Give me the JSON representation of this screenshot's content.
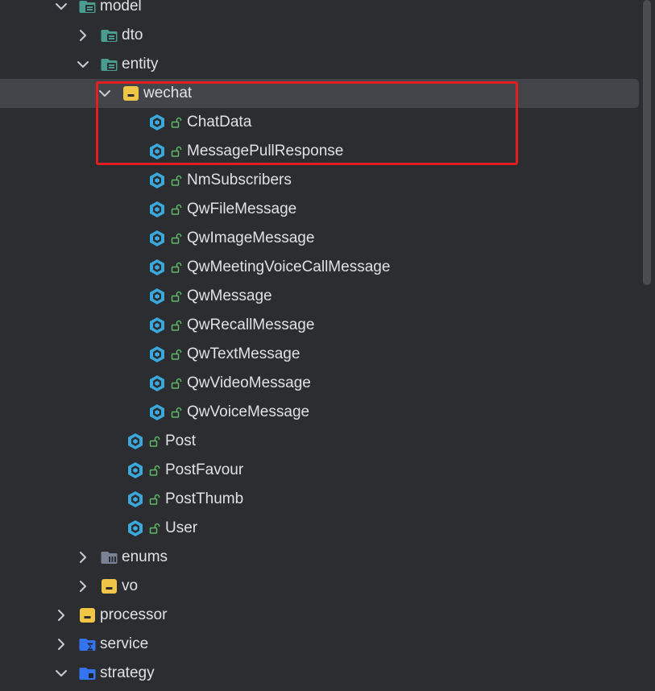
{
  "tree": {
    "rows": [
      {
        "label": "model",
        "icon": "folder-package-icon",
        "expanded": true
      },
      {
        "label": "dto",
        "icon": "folder-package-icon",
        "expanded": false
      },
      {
        "label": "entity",
        "icon": "folder-package-icon",
        "expanded": true
      },
      {
        "label": "wechat",
        "icon": "folder-yellow-icon",
        "expanded": true,
        "selected": true
      },
      {
        "label": "ChatData",
        "icon": "class-icon"
      },
      {
        "label": "MessagePullResponse",
        "icon": "class-icon"
      },
      {
        "label": "NmSubscribers",
        "icon": "class-icon"
      },
      {
        "label": "QwFileMessage",
        "icon": "class-icon"
      },
      {
        "label": "QwImageMessage",
        "icon": "class-icon"
      },
      {
        "label": "QwMeetingVoiceCallMessage",
        "icon": "class-icon"
      },
      {
        "label": "QwMessage",
        "icon": "class-icon"
      },
      {
        "label": "QwRecallMessage",
        "icon": "class-icon"
      },
      {
        "label": "QwTextMessage",
        "icon": "class-icon"
      },
      {
        "label": "QwVideoMessage",
        "icon": "class-icon"
      },
      {
        "label": "QwVoiceMessage",
        "icon": "class-icon"
      },
      {
        "label": "Post",
        "icon": "class-icon"
      },
      {
        "label": "PostFavour",
        "icon": "class-icon"
      },
      {
        "label": "PostThumb",
        "icon": "class-icon"
      },
      {
        "label": "User",
        "icon": "class-icon"
      },
      {
        "label": "enums",
        "icon": "folder-enum-icon",
        "expanded": false
      },
      {
        "label": "vo",
        "icon": "folder-yellow-icon",
        "expanded": false
      },
      {
        "label": "processor",
        "icon": "folder-yellow-icon",
        "expanded": false
      },
      {
        "label": "service",
        "icon": "folder-service-icon",
        "expanded": false
      },
      {
        "label": "strategy",
        "icon": "folder-strategy-icon",
        "expanded": true
      }
    ]
  },
  "colors": {
    "background": "#2b2d30",
    "selection": "#43454a",
    "text": "#dfe1e5",
    "chevron": "#c9ccd2",
    "class_icon": "#3ba8dc",
    "lock": "#5fb865",
    "package_folder": "#4a9d8e",
    "yellow_folder": "#f0c647",
    "blue_folder": "#3574f0",
    "highlight_box": "#e51d21"
  }
}
